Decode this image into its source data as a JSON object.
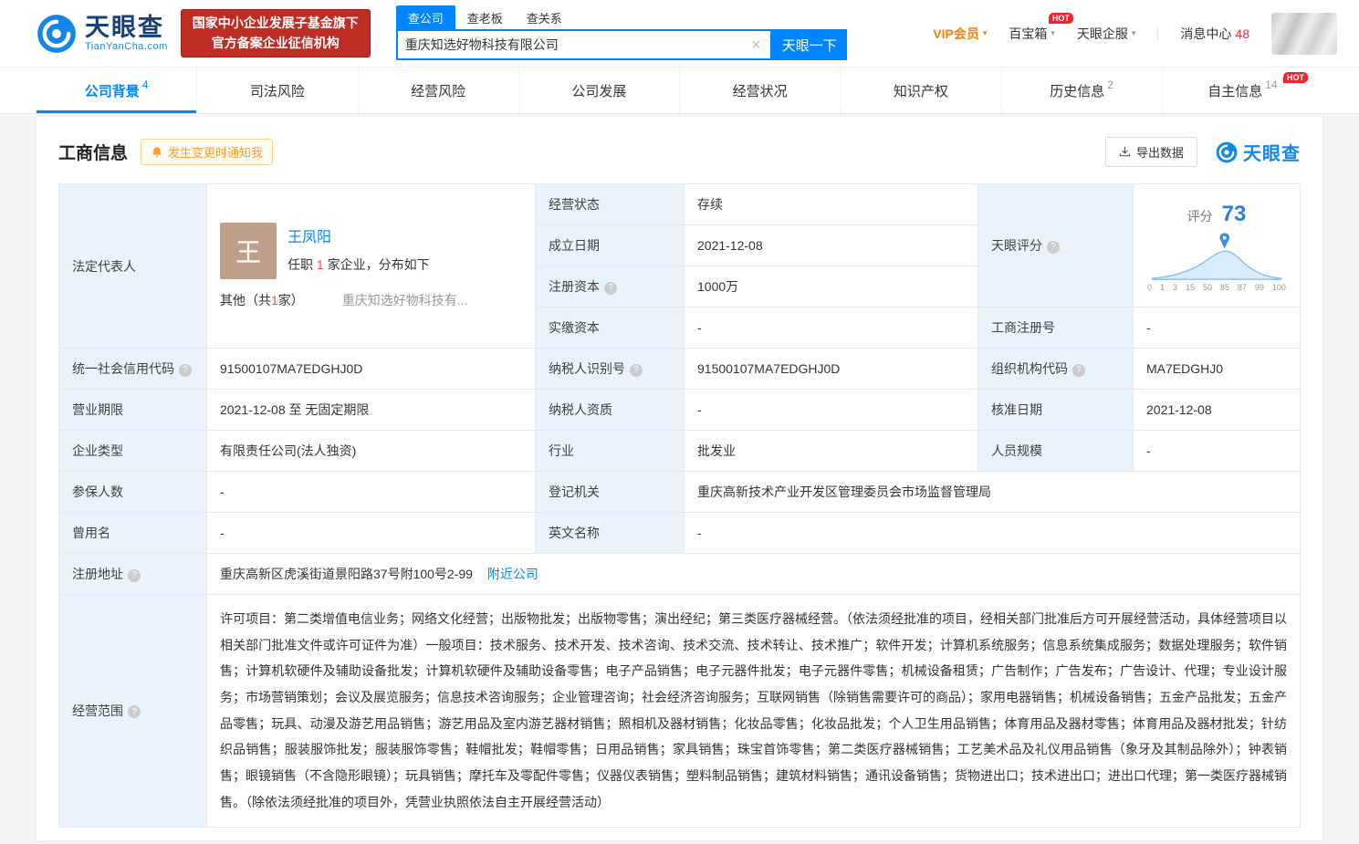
{
  "icons": {
    "help": "?",
    "clear": "×",
    "caret": "▾"
  },
  "brand": {
    "name": "天眼查",
    "domain": "TianYanCha.com",
    "cert_line1": "国家中小企业发展子基金旗下",
    "cert_line2": "官方备案企业征信机构"
  },
  "search": {
    "tabs": [
      {
        "label": "查公司"
      },
      {
        "label": "查老板"
      },
      {
        "label": "查关系"
      }
    ],
    "value": "重庆知选好物科技有限公司",
    "button": "天眼一下"
  },
  "topnav": {
    "vip": "VIP会员",
    "toolbox": "百宝箱",
    "services": "天眼企服",
    "messages": "消息中心",
    "message_count": "48",
    "hot": "HOT"
  },
  "tabs": [
    {
      "label": "公司背景",
      "count": "4"
    },
    {
      "label": "司法风险",
      "count": ""
    },
    {
      "label": "经营风险",
      "count": ""
    },
    {
      "label": "公司发展",
      "count": ""
    },
    {
      "label": "经营状况",
      "count": ""
    },
    {
      "label": "知识产权",
      "count": ""
    },
    {
      "label": "历史信息",
      "count": "2"
    },
    {
      "label": "自主信息",
      "count": "14",
      "hot": "HOT"
    }
  ],
  "section": {
    "title": "工商信息",
    "notify": "发生变更时通知我",
    "export": "导出数据",
    "logo": "天眼查"
  },
  "legal_rep": {
    "label": "法定代表人",
    "avatar": "王",
    "name": "王凤阳",
    "role_prefix": "任职",
    "role_count": "1",
    "role_suffix": "家企业，分布如下",
    "other_pre": "其他（共",
    "other_count": "1",
    "other_post": "家）",
    "company": "重庆知选好物科技有..."
  },
  "score": {
    "label": "天眼评分",
    "caption": "评分",
    "value": "73",
    "axis": [
      "0",
      "1",
      "3",
      "15",
      "50",
      "85",
      "87",
      "99",
      "100"
    ]
  },
  "fields": {
    "status": {
      "label": "经营状态",
      "value": "存续"
    },
    "established": {
      "label": "成立日期",
      "value": "2021-12-08"
    },
    "reg_capital": {
      "label": "注册资本",
      "value": "1000万"
    },
    "paid_capital": {
      "label": "实缴资本",
      "value": "-"
    },
    "reg_no": {
      "label": "工商注册号",
      "value": "-"
    },
    "credit_code": {
      "label": "统一社会信用代码",
      "value": "91500107MA7EDGHJ0D"
    },
    "taxpayer_no": {
      "label": "纳税人识别号",
      "value": "91500107MA7EDGHJ0D"
    },
    "org_code": {
      "label": "组织机构代码",
      "value": "MA7EDGHJ0"
    },
    "term": {
      "label": "营业期限",
      "value": "2021-12-08 至 无固定期限"
    },
    "taxpayer_quality": {
      "label": "纳税人资质",
      "value": "-"
    },
    "approved": {
      "label": "核准日期",
      "value": "2021-12-08"
    },
    "type": {
      "label": "企业类型",
      "value": "有限责任公司(法人独资)"
    },
    "industry": {
      "label": "行业",
      "value": "批发业"
    },
    "staff": {
      "label": "人员规模",
      "value": "-"
    },
    "insured": {
      "label": "参保人数",
      "value": "-"
    },
    "authority": {
      "label": "登记机关",
      "value": "重庆高新技术产业开发区管理委员会市场监督管理局"
    },
    "former_name": {
      "label": "曾用名",
      "value": "-"
    },
    "english_name": {
      "label": "英文名称",
      "value": "-"
    },
    "address": {
      "label": "注册地址",
      "value": "重庆高新区虎溪街道景阳路37号附100号2-99",
      "link": "附近公司"
    },
    "scope": {
      "label": "经营范围",
      "value": "许可项目：第二类增值电信业务；网络文化经营；出版物批发；出版物零售；演出经纪；第三类医疗器械经营。（依法须经批准的项目，经相关部门批准后方可开展经营活动，具体经营项目以相关部门批准文件或许可证件为准）一般项目：技术服务、技术开发、技术咨询、技术交流、技术转让、技术推广；软件开发；计算机系统服务；信息系统集成服务；数据处理服务；软件销售；计算机软硬件及辅助设备批发；计算机软硬件及辅助设备零售；电子产品销售；电子元器件批发；电子元器件零售；机械设备租赁；广告制作；广告发布；广告设计、代理；专业设计服务；市场营销策划；会议及展览服务；信息技术咨询服务；企业管理咨询；社会经济咨询服务；互联网销售（除销售需要许可的商品）；家用电器销售；机械设备销售；五金产品批发；五金产品零售；玩具、动漫及游艺用品销售；游艺用品及室内游艺器材销售；照相机及器材销售；化妆品零售；化妆品批发；个人卫生用品销售；体育用品及器材零售；体育用品及器材批发；针纺织品销售；服装服饰批发；服装服饰零售；鞋帽批发；鞋帽零售；日用品销售；家具销售；珠宝首饰零售；第二类医疗器械销售；工艺美术品及礼仪用品销售（象牙及其制品除外）；钟表销售；眼镜销售（不含隐形眼镜）；玩具销售；摩托车及零配件零售；仪器仪表销售；塑料制品销售；建筑材料销售；通讯设备销售；货物进出口；技术进出口；进出口代理；第一类医疗器械销售。（除依法须经批准的项目外，凭营业执照依法自主开展经营活动）"
    }
  }
}
